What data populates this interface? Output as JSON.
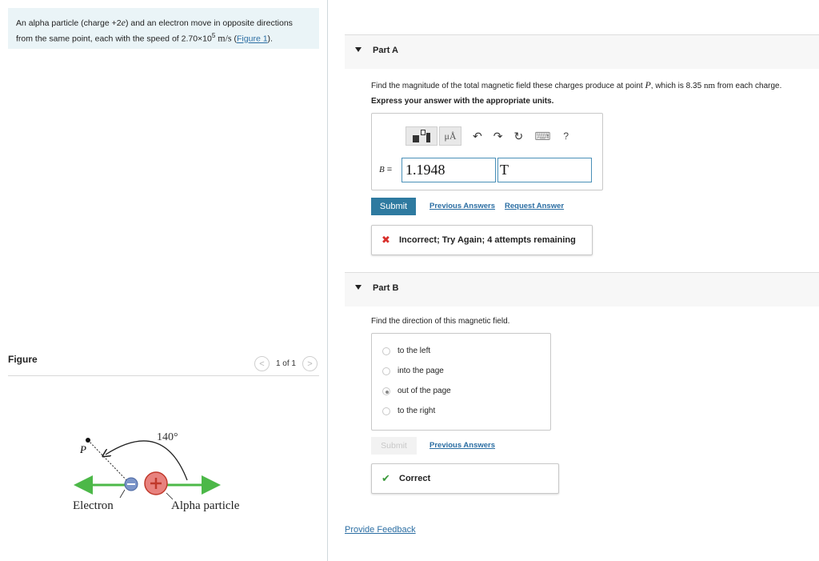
{
  "problem": {
    "text_before": "An alpha particle (charge +2",
    "charge_symbol": "e",
    "text_middle": ") and an electron move in opposite directions from the same point, each with the speed of 2.70×10",
    "exponent": "5",
    "units": "m/s",
    "open_paren": " (",
    "figure_link": "Figure 1",
    "close_paren": ")."
  },
  "figure": {
    "title": "Figure",
    "counter": "1 of 1",
    "prev_icon": "<",
    "next_icon": ">",
    "angle_label": "140°",
    "point_label": "P",
    "electron_label": "Electron",
    "alpha_label": "Alpha particle",
    "colors": {
      "arrow": "#4cb848",
      "electron": "#7b95c9",
      "alpha": "#d9534f"
    }
  },
  "part_a": {
    "title": "Part A",
    "question_before": "Find the magnitude of the total magnetic field these charges produce at point ",
    "point": "P",
    "question_middle": ", which is 8.35 ",
    "distance_unit": "nm",
    "question_after": " from each charge.",
    "instruction": "Express your answer with the appropriate units.",
    "toolbar": {
      "templates_icon": "templates-icon",
      "units_label": "μÅ",
      "undo": "↶",
      "redo": "↷",
      "reset": "↻",
      "keyboard": "⌨",
      "help": "?"
    },
    "variable_label": "B",
    "equals": " =",
    "value": "1.1948",
    "unit": "T",
    "submit_label": "Submit",
    "previous_answers_label": "Previous Answers",
    "request_answer_label": "Request Answer",
    "feedback_icon": "✖",
    "feedback_text": "Incorrect; Try Again; 4 attempts remaining",
    "feedback_color": "#d9302c"
  },
  "part_b": {
    "title": "Part B",
    "question": "Find the direction of this magnetic field.",
    "options": [
      "to the left",
      "into the page",
      "out of the page",
      "to the right"
    ],
    "selected": "out of the page",
    "submit_label": "Submit",
    "previous_answers_label": "Previous Answers",
    "feedback_icon": "✔",
    "feedback_text": "Correct",
    "feedback_color": "#3c9a3c"
  },
  "footer": {
    "provide_feedback_label": "Provide Feedback"
  }
}
